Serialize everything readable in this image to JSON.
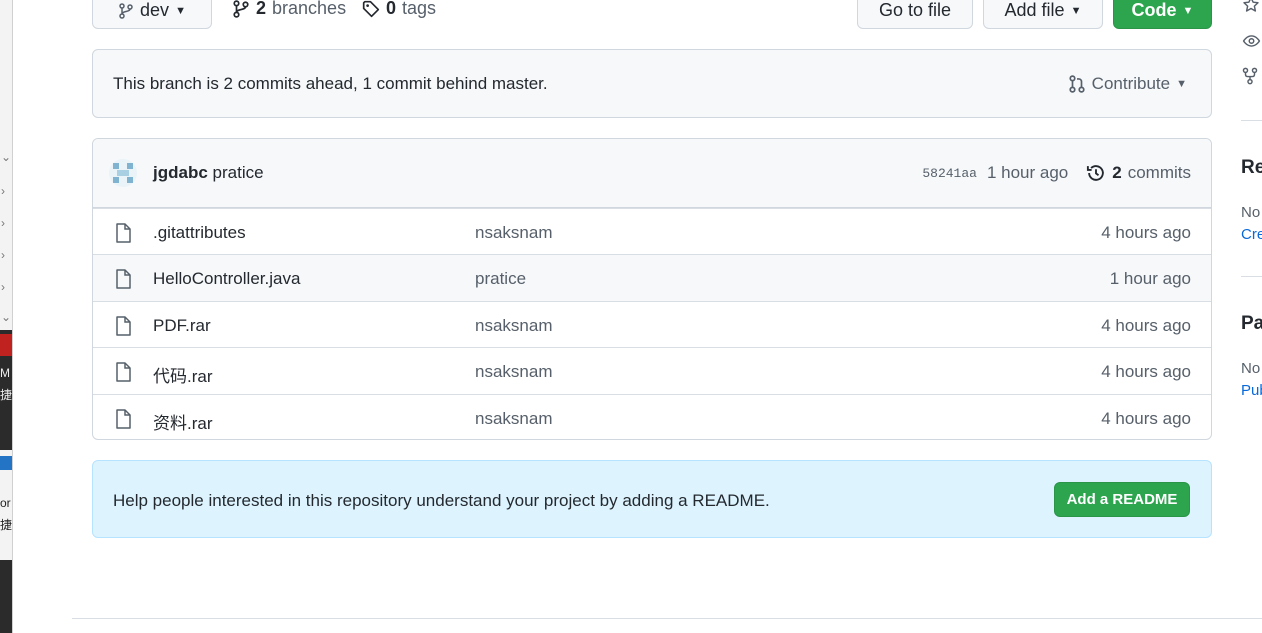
{
  "toolbar": {
    "branch_name": "dev",
    "branches_count": "2",
    "branches_label": "branches",
    "tags_count": "0",
    "tags_label": "tags",
    "go_to_file": "Go to file",
    "add_file": "Add file",
    "code": "Code"
  },
  "branch_status": {
    "message": "This branch is 2 commits ahead, 1 commit behind master.",
    "contribute": "Contribute"
  },
  "latest_commit": {
    "author": "jgdabc",
    "message": "pratice",
    "sha": "58241aa",
    "time": "1 hour ago",
    "commits_count": "2",
    "commits_label": "commits"
  },
  "files": [
    {
      "name": ".gitattributes",
      "message": "nsaksnam",
      "age": "4 hours ago"
    },
    {
      "name": "HelloController.java",
      "message": "pratice",
      "age": "1 hour ago"
    },
    {
      "name": "PDF.rar",
      "message": "nsaksnam",
      "age": "4 hours ago"
    },
    {
      "name": "代码.rar",
      "message": "nsaksnam",
      "age": "4 hours ago"
    },
    {
      "name": "资料.rar",
      "message": "nsaksnam",
      "age": "4 hours ago"
    }
  ],
  "readme_prompt": {
    "message": "Help people interested in this repository understand your project by adding a README.",
    "button": "Add a README"
  },
  "sidebar": {
    "releases_heading": "Re",
    "releases_text": "No",
    "releases_link": "Cre",
    "packages_heading": "Pa",
    "packages_text": "No",
    "packages_link": "Pub"
  },
  "left_window": {
    "text_1": "M",
    "text_2": "捷",
    "text_3": "or",
    "text_4": "捷"
  },
  "colors": {
    "primary_green": "#2da44e",
    "readme_bg": "#ddf4ff",
    "link_blue": "#0969da"
  }
}
